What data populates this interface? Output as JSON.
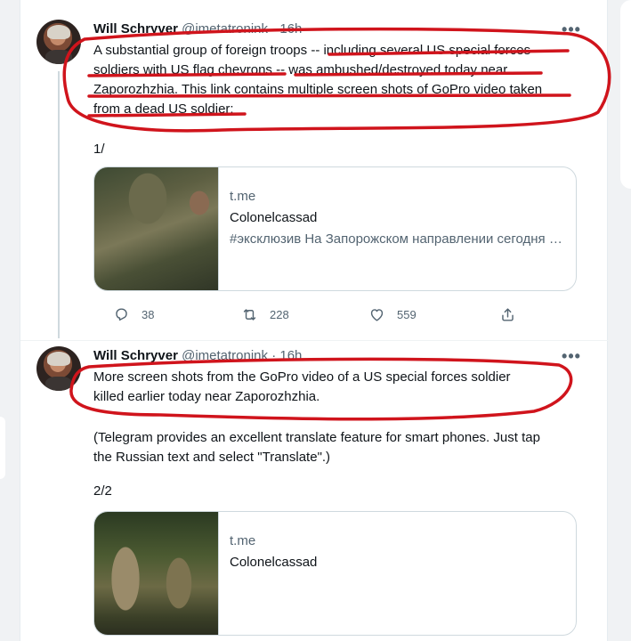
{
  "tweets": [
    {
      "author_name": "Will Schryver",
      "author_handle": "@imetatronink",
      "separator": "·",
      "time": "16h",
      "more_label": "•••",
      "text_lines": [
        "A substantial group of foreign troops -- including several US special forces",
        "soldiers with US flag chevrons -- was ambushed/destroyed today near",
        "Zaporozhzhia. This link contains multiple screen shots of GoPro video taken",
        "from a dead US soldier:"
      ],
      "thread_number": "1/",
      "card": {
        "domain": "t.me",
        "title": "Colonelcassad",
        "description": "#эксклюзив На Запорожском направлении сегодня была вылазка иностранных наёмников в..."
      },
      "stats": {
        "replies": "38",
        "retweets": "228",
        "likes": "559"
      }
    },
    {
      "author_name": "Will Schryver",
      "author_handle": "@imetatronink",
      "separator": "·",
      "time": "16h",
      "more_label": "•••",
      "text_lines": [
        "More screen shots from the GoPro video of a US special forces soldier",
        "killed earlier today near Zaporozhzhia."
      ],
      "note_lines": [
        "(Telegram provides an excellent translate feature for smart phones. Just tap",
        "the Russian text and select \"Translate\".)"
      ],
      "thread_number": "2/2",
      "card": {
        "domain": "t.me",
        "title": "Colonelcassad"
      }
    }
  ],
  "icons": {
    "reply": "reply-icon",
    "retweet": "retweet-icon",
    "like": "heart-icon",
    "share": "share-icon",
    "more": "more-icon"
  },
  "colors": {
    "annotation": "#d0141c",
    "secondary_text": "#536471",
    "border": "#cfd9de"
  }
}
